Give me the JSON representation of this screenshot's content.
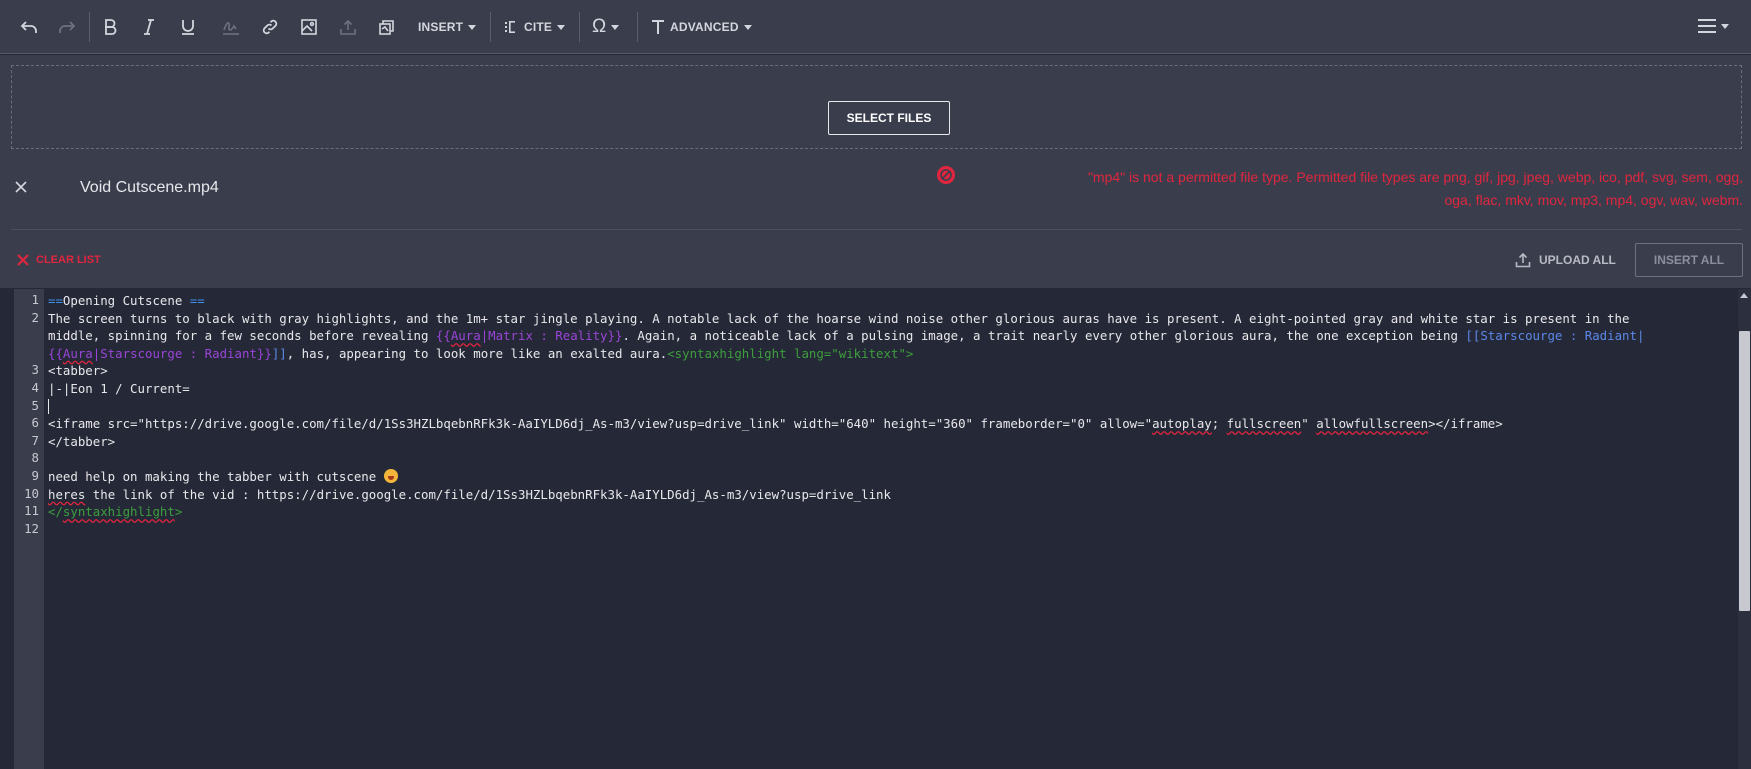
{
  "toolbar": {
    "insert_label": "INSERT",
    "cite_label": "CITE",
    "advanced_label": "ADVANCED"
  },
  "upload": {
    "select_files_label": "SELECT FILES",
    "file_name": "Void Cutscene.mp4",
    "error_line1": "\"mp4\" is not a permitted file type. Permitted file types are png, gif, jpg, jpeg, webp, ico, pdf, svg, sem, ogg,",
    "error_line2": "oga, flac, mkv, mov, mp3, mp4, ogv, wav, webm.",
    "clear_list_label": "CLEAR LIST",
    "upload_all_label": "UPLOAD ALL",
    "insert_all_label": "INSERT ALL",
    "error_color": "#e0263f"
  },
  "editor": {
    "line_numbers": [
      "1",
      "2",
      "3",
      "4",
      "5",
      "6",
      "7",
      "8",
      "9",
      "10",
      "11",
      "12"
    ],
    "l1": {
      "open": "==",
      "text": "Opening Cutscene ",
      "close": "=="
    },
    "l2a": "The screen turns to black with gray highlights, and the 1m+ star jingle playing. A notable lack of the hoarse wind noise other glorious auras have is present. A eight-pointed gray and white star is present in the",
    "l2b_pre": "middle, spinning for a few seconds before revealing ",
    "l2b_tmpl_open": "{{",
    "l2b_tmpl_name": "Aura",
    "l2b_tmpl_rest": "|Matrix : Reality}}",
    "l2b_mid": ". Again, a noticeable lack of a pulsing image, a trait nearly every other glorious aura, the one exception being ",
    "l2b_link": "[[Starscourge : Radiant|",
    "l2c_tmpl_open": "{{",
    "l2c_tmpl_name": "Aura",
    "l2c_tmpl_rest": "|Starscourge : Radiant}}",
    "l2c_link_close": "]]",
    "l2c_text": ", has, appearing to look more like an exalted aura.",
    "l2c_tag": "<syntaxhighlight lang=\"wikitext\">",
    "l3": "<tabber>",
    "l4": "|-|Eon 1 / Current=",
    "l6_pre": "<iframe src=\"https://drive.google.com/file/d/1Ss3HZLbqebnRFk3k-AaIYLD6dj_As-m3/view?usp=drive_link\" width=\"640\" height=\"360\" frameborder=\"0\" allow=\"",
    "l6_w1": "autoplay",
    "l6_mid": "; ",
    "l6_w2": "fullscreen",
    "l6_mid2": "\" ",
    "l6_w3": "allowfullscreen",
    "l6_post": "></iframe>",
    "l7": "</tabber>",
    "l9": "need help on making the tabber with cutscene ",
    "l10_w": "heres",
    "l10_rest": " the link of the vid : https://drive.google.com/file/d/1Ss3HZLbqebnRFk3k-AaIYLD6dj_As-m3/view?usp=drive_link",
    "l11_open": "</",
    "l11_name": "syntaxhighlight",
    "l11_close": ">"
  }
}
